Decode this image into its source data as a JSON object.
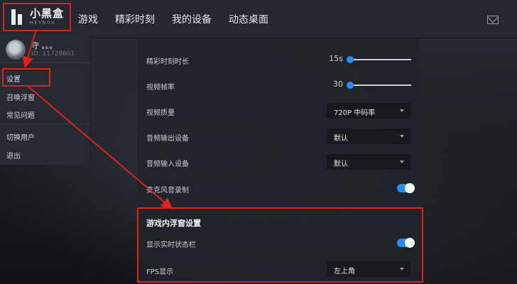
{
  "brand": {
    "name_cn": "小黑盒",
    "name_en": "HEYBOX"
  },
  "nav": [
    "游戏",
    "精彩时刻",
    "我的设备",
    "动态桌面"
  ],
  "user": {
    "name": "守 。。。",
    "id": "ID: 11728601"
  },
  "menu": {
    "items": [
      "设置",
      "召唤浮窗",
      "常见问题",
      "切换用户",
      "退出"
    ]
  },
  "settings": {
    "highlight_duration": {
      "label": "精彩时刻时长",
      "value": "15s",
      "level": 0
    },
    "frame_rate": {
      "label": "视频帧率",
      "value": "30",
      "level": 0
    },
    "quality": {
      "label": "视频质量",
      "value": "720P 中码率"
    },
    "audio_out": {
      "label": "音频输出设备",
      "value": "默认"
    },
    "audio_in": {
      "label": "音频输入设备",
      "value": "默认"
    },
    "mic": {
      "label": "麦克风音录制",
      "on": true
    },
    "overlay": {
      "title": "游戏内浮窗设置",
      "status_bar": {
        "label": "显示实时状态栏",
        "on": true
      },
      "fps": {
        "label": "FPS显示",
        "value": "左上角"
      }
    }
  },
  "colors": {
    "accent": "#2a8cff",
    "annotation": "#e0201a"
  }
}
